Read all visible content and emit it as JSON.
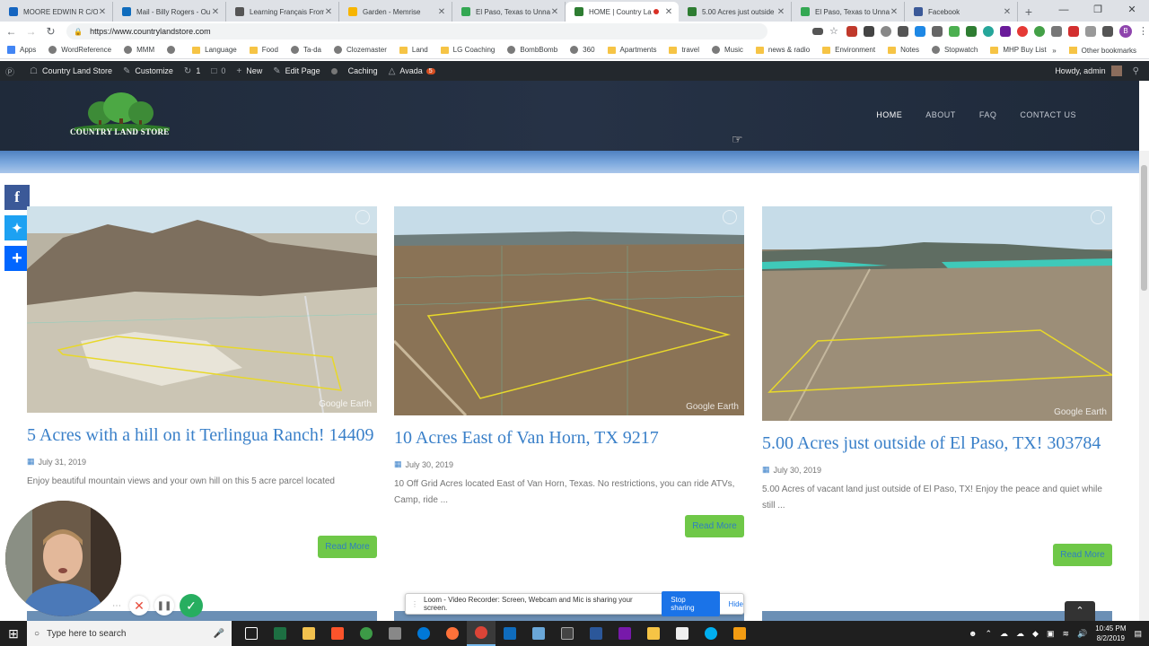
{
  "browser": {
    "tabs": [
      {
        "title": "MOORE EDWIN R C/O",
        "color": "#1565c0",
        "active": false
      },
      {
        "title": "Mail - Billy Rogers - Ou",
        "color": "#0f6cbd",
        "active": false
      },
      {
        "title": "Learning Français From",
        "color": "#555555",
        "active": false
      },
      {
        "title": "Garden - Memrise",
        "color": "#f7b500",
        "active": false
      },
      {
        "title": "El Paso, Texas to Unnar",
        "color": "#34a853",
        "active": false
      },
      {
        "title": "HOME | Country La",
        "color": "#2e7d32",
        "active": true
      },
      {
        "title": "5.00 Acres just outside",
        "color": "#2e7d32",
        "active": false
      },
      {
        "title": "El Paso, Texas to Unnar",
        "color": "#34a853",
        "active": false
      },
      {
        "title": "Facebook",
        "color": "#3b5998",
        "active": false
      }
    ],
    "url": "https://www.countrylandstore.com",
    "profile_initial": "B",
    "bookmarks": [
      {
        "label": "Apps",
        "kind": "apps"
      },
      {
        "label": "WordReference",
        "kind": "site"
      },
      {
        "label": "MMM",
        "kind": "site"
      },
      {
        "label": "",
        "kind": "site"
      },
      {
        "label": "Language",
        "kind": "folder"
      },
      {
        "label": "Food",
        "kind": "folder"
      },
      {
        "label": "Ta-da",
        "kind": "site"
      },
      {
        "label": "Clozemaster",
        "kind": "site"
      },
      {
        "label": "Land",
        "kind": "folder"
      },
      {
        "label": "LG Coaching",
        "kind": "folder"
      },
      {
        "label": "BombBomb",
        "kind": "site"
      },
      {
        "label": "360",
        "kind": "site"
      },
      {
        "label": "Apartments",
        "kind": "folder"
      },
      {
        "label": "travel",
        "kind": "folder"
      },
      {
        "label": "Music",
        "kind": "site"
      },
      {
        "label": "news & radio",
        "kind": "folder"
      },
      {
        "label": "Environment",
        "kind": "folder"
      },
      {
        "label": "Notes",
        "kind": "folder"
      },
      {
        "label": "Stopwatch",
        "kind": "site"
      },
      {
        "label": "MHP Buy List",
        "kind": "folder"
      }
    ],
    "other_bookmarks": "Other bookmarks"
  },
  "wpbar": {
    "site": "Country Land Store",
    "customize": "Customize",
    "updates": "1",
    "comments": "0",
    "new": "New",
    "edit": "Edit Page",
    "caching": "Caching",
    "avada": "Avada",
    "avada_badge": "5",
    "howdy": "Howdy, admin"
  },
  "site": {
    "logo_text": "COUNTRY LAND STORE",
    "nav": [
      "HOME",
      "ABOUT",
      "FAQ",
      "CONTACT US"
    ]
  },
  "posts": [
    {
      "title": "5 Acres with a hill on it Terlingua Ranch! 14409",
      "date": "July 31, 2019",
      "excerpt": "Enjoy beautiful mountain views and your own hill on this 5 acre parcel located",
      "readmore": "Read More",
      "watermark": "Google Earth"
    },
    {
      "title": "10 Acres East of Van Horn, TX 9217",
      "date": "July 30, 2019",
      "excerpt": "10 Off Grid Acres located East of Van Horn, Texas. No restrictions, you can ride ATVs, Camp, ride ...",
      "readmore": "Read More",
      "watermark": "Google Earth"
    },
    {
      "title": "5.00 Acres just outside of El Paso, TX! 303784",
      "date": "July 30, 2019",
      "excerpt": "5.00 Acres of vacant land just outside of El Paso, TX! Enjoy the peace and quiet while still ...",
      "readmore": "Read More",
      "watermark": "Google Earth"
    }
  ],
  "loom": {
    "message": "Loom - Video Recorder: Screen, Webcam and Mic is sharing your screen.",
    "stop": "Stop sharing",
    "hide": "Hide"
  },
  "taskbar": {
    "search_placeholder": "Type here to search",
    "time": "10:45 PM",
    "date": "8/2/2019"
  }
}
